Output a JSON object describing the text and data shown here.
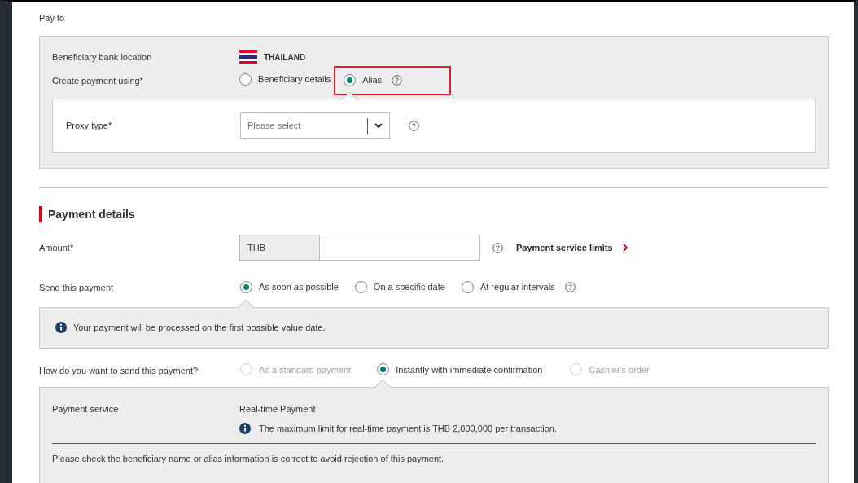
{
  "pay_to": {
    "title": "Pay to",
    "location_label": "Beneficiary bank location",
    "location_value": "THAILAND",
    "method_label": "Create payment using*",
    "method_options": [
      {
        "label": "Beneficiary details",
        "selected": false,
        "highlighted": false
      },
      {
        "label": "Alias",
        "selected": true,
        "highlighted": true
      }
    ],
    "method_help": true,
    "proxy": {
      "label": "Proxy type*",
      "placeholder": "Please select"
    }
  },
  "payment_details": {
    "title": "Payment details",
    "amount_label": "Amount*",
    "currency": "THB",
    "limits_link": "Payment service limits",
    "send_label": "Send this payment",
    "send_options": [
      {
        "label": "As soon as possible",
        "selected": true,
        "disabled": false
      },
      {
        "label": "On a specific date",
        "selected": false,
        "disabled": false
      },
      {
        "label": "At regular intervals",
        "selected": false,
        "disabled": false
      }
    ],
    "send_help": true,
    "send_info": "Your payment will be processed on the first possible value date.",
    "method_label": "How do you want to send this payment?",
    "method_options": [
      {
        "label": "As a standard payment",
        "selected": false,
        "disabled": true
      },
      {
        "label": "Instantly with immediate confirmation",
        "selected": true,
        "disabled": false
      },
      {
        "label": "Cashier's order",
        "selected": false,
        "disabled": true
      }
    ],
    "service_label": "Payment service",
    "service_value": "Real-time Payment",
    "service_info": "The maximum limit for real-time payment is THB 2,000,000 per transaction.",
    "note": "Please check the beneficiary name or alias information is correct to avoid rejection of this payment."
  }
}
